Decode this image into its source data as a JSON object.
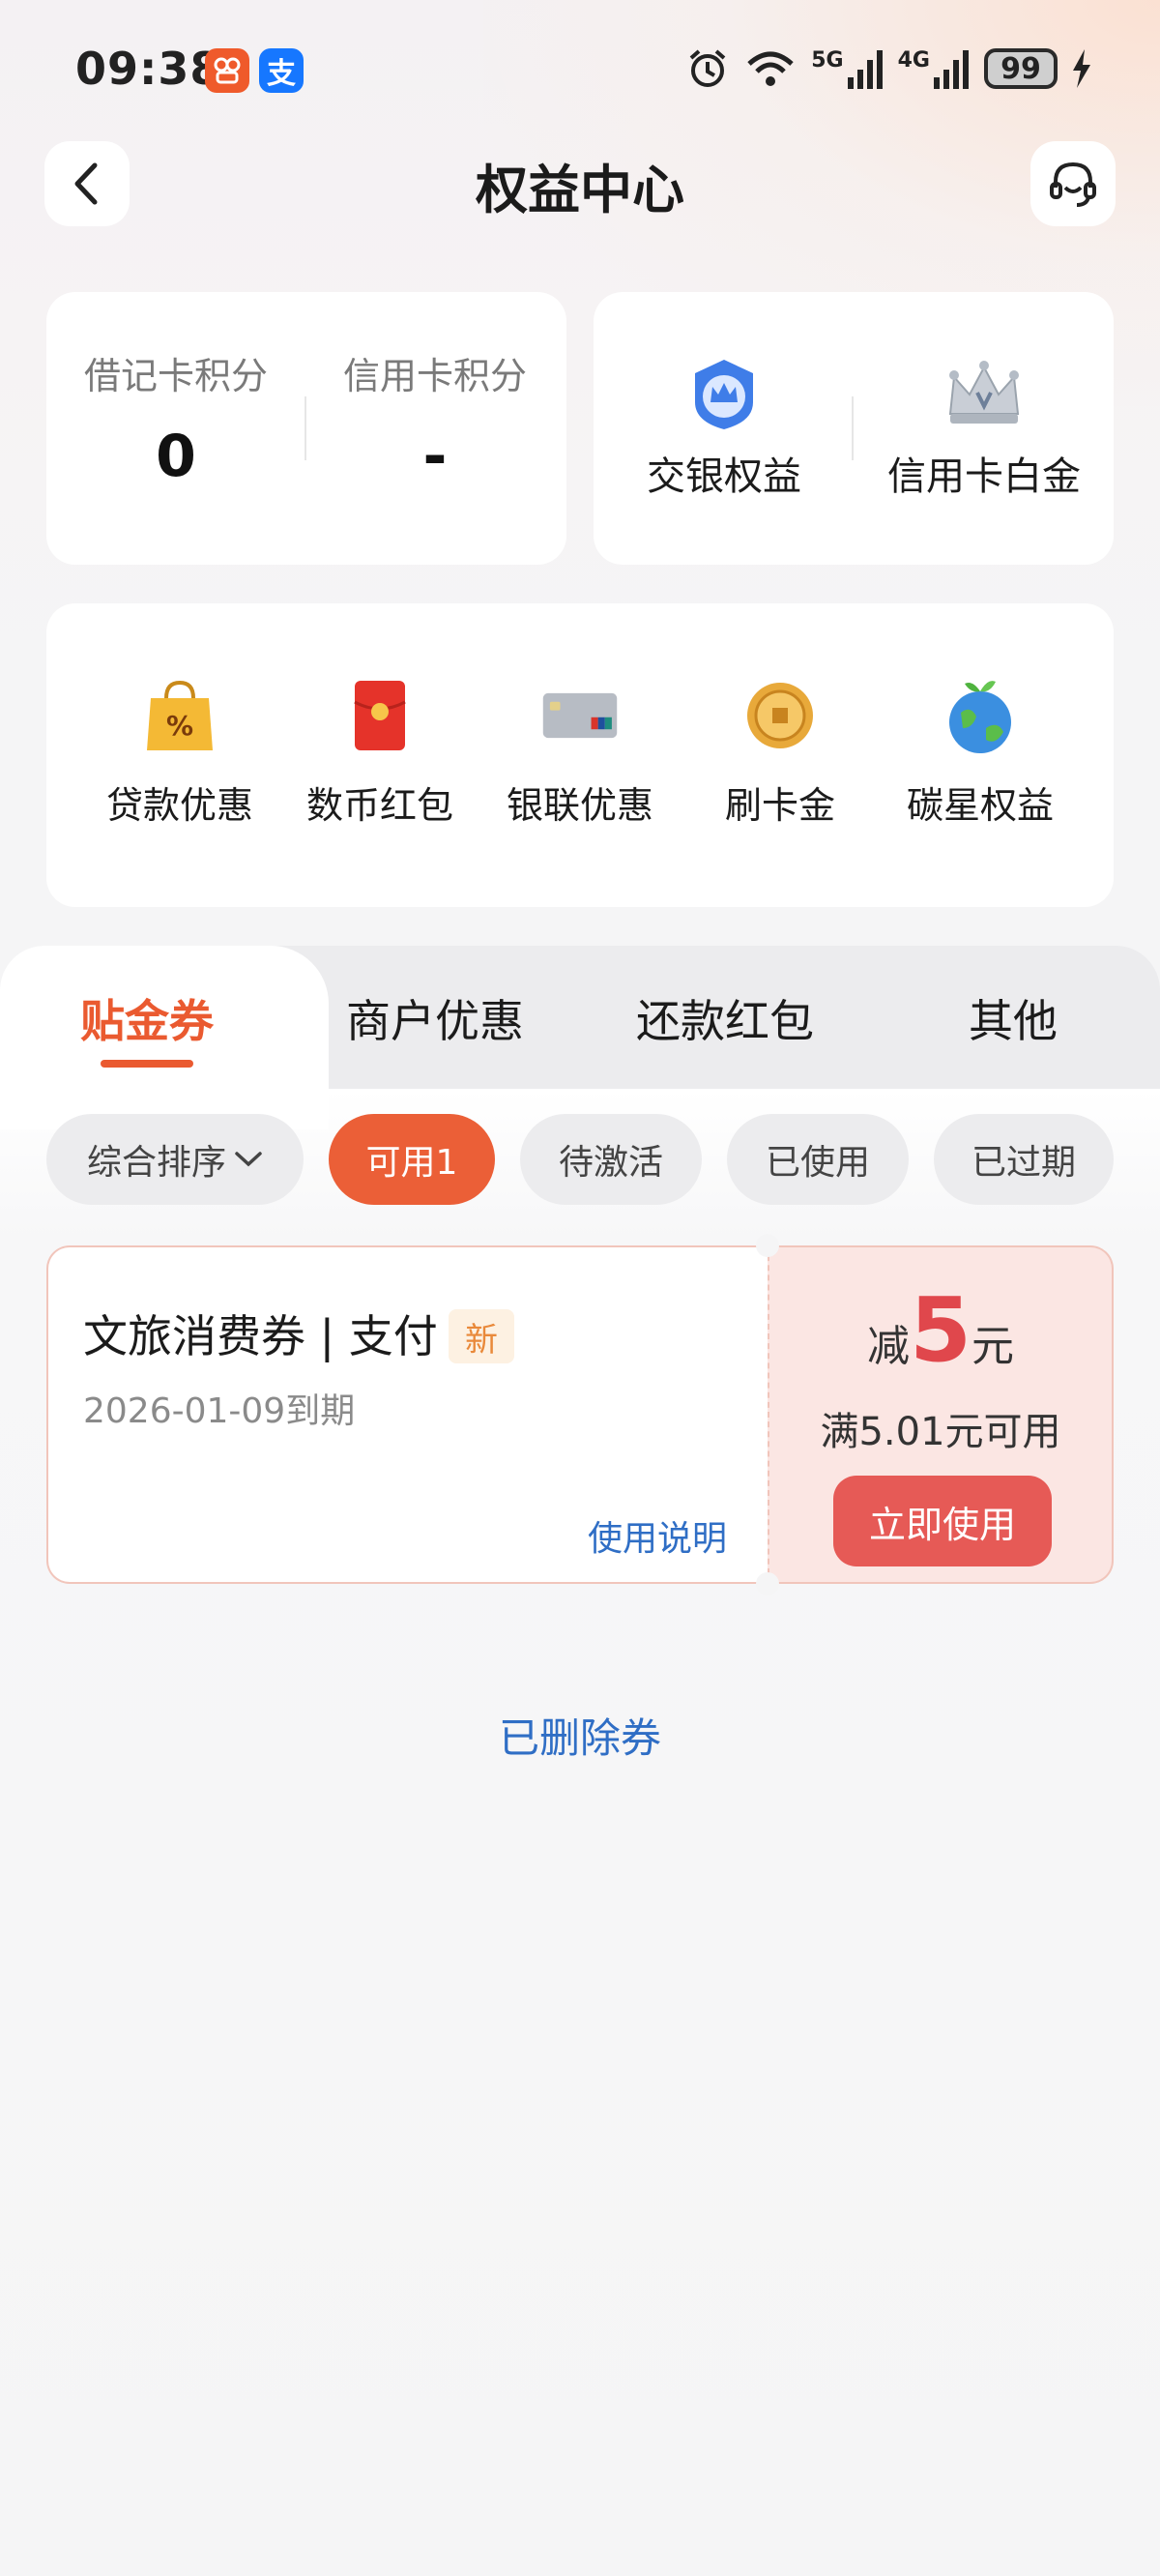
{
  "status_bar": {
    "time": "09:38",
    "app_badge_1": "ઇ",
    "app_badge_2": "支",
    "network_1": "5G",
    "network_2": "4G",
    "battery": "99"
  },
  "header": {
    "title": "权益中心"
  },
  "points_card": {
    "debit_label": "借记卡积分",
    "debit_value": "0",
    "credit_label": "信用卡积分",
    "credit_value": "-"
  },
  "benefit_card": {
    "item1_label": "交银权益",
    "item2_label": "信用卡白金"
  },
  "quick_entries": [
    {
      "label": "贷款优惠",
      "icon": "loan-bag-icon"
    },
    {
      "label": "数币红包",
      "icon": "red-envelope-icon"
    },
    {
      "label": "银联优惠",
      "icon": "unionpay-card-icon"
    },
    {
      "label": "刷卡金",
      "icon": "gold-coin-icon"
    },
    {
      "label": "碳星权益",
      "icon": "earth-icon"
    }
  ],
  "tabs": [
    {
      "label": "贴金券",
      "active": true
    },
    {
      "label": "商户优惠",
      "active": false
    },
    {
      "label": "还款红包",
      "active": false
    },
    {
      "label": "其他",
      "active": false
    }
  ],
  "filters": {
    "sort_label": "综合排序",
    "chips": [
      "可用1",
      "待激活",
      "已使用",
      "已过期"
    ],
    "active_chip": "可用1"
  },
  "coupon": {
    "name": "文旅消费券 | 支付",
    "tag": "新",
    "expiry": "2026-01-09到期",
    "usage_link": "使用说明",
    "discount_prefix": "减",
    "discount_amount": "5",
    "discount_unit": "元",
    "condition": "满5.01元可用",
    "use_button": "立即使用"
  },
  "deleted_link": "已删除券",
  "colors": {
    "accent": "#ea5a30",
    "link": "#2f6ec5",
    "coupon_red": "#e0474c"
  }
}
